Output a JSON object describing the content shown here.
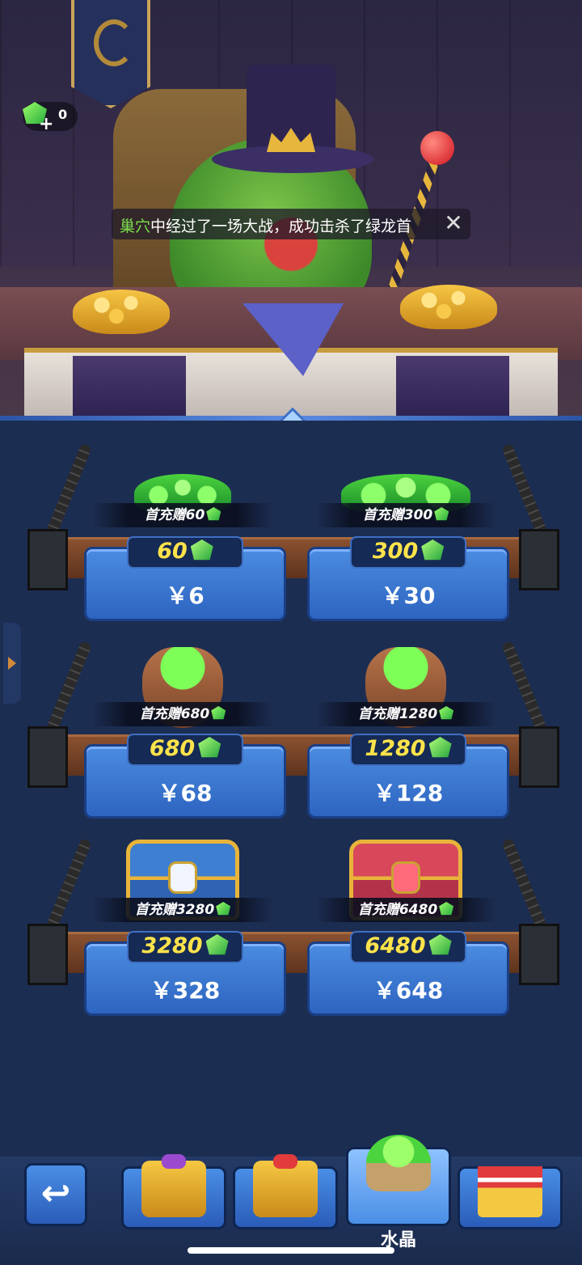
{
  "hud": {
    "gem_count": "0"
  },
  "notice": {
    "highlight": "巢穴",
    "text": "中经过了一场大战，成功击杀了绿龙首",
    "close_glyph": "✕"
  },
  "shop": {
    "items": [
      {
        "bonus": "首充赠60",
        "amount": "60",
        "price": "￥6",
        "loot": "gem-pile-small"
      },
      {
        "bonus": "首充赠300",
        "amount": "300",
        "price": "￥30",
        "loot": "gem-pile-large"
      },
      {
        "bonus": "首充赠680",
        "amount": "680",
        "price": "￥68",
        "loot": "gem-sack"
      },
      {
        "bonus": "首充赠1280",
        "amount": "1280",
        "price": "￥128",
        "loot": "gem-sack-overflow"
      },
      {
        "bonus": "首充赠3280",
        "amount": "3280",
        "price": "￥328",
        "loot": "blue-chest"
      },
      {
        "bonus": "首充赠6480",
        "amount": "6480",
        "price": "￥648",
        "loot": "red-chest"
      }
    ]
  },
  "navbar": {
    "back_glyph": "↩",
    "tabs": [
      {
        "icon": "purple-gift-box-icon"
      },
      {
        "icon": "red-gift-box-icon"
      },
      {
        "icon": "crystal-cart-icon",
        "label": "水晶",
        "active": true
      },
      {
        "icon": "market-stall-icon"
      }
    ]
  }
}
